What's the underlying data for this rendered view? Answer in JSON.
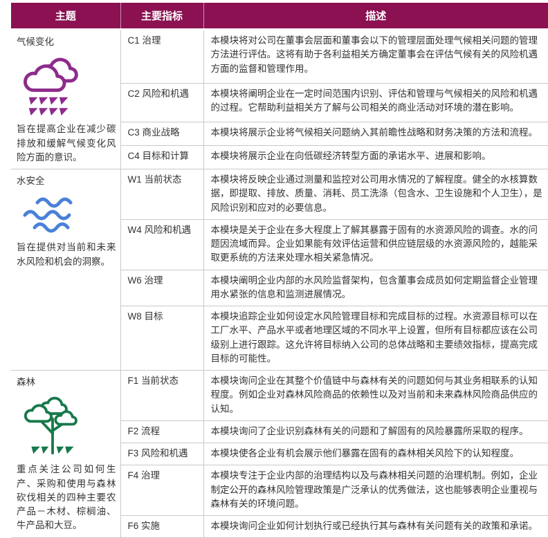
{
  "header": {
    "theme": "主题",
    "indicator": "主要指标",
    "description": "描述"
  },
  "sections": [
    {
      "id": "climate",
      "theme_title": "气候变化",
      "theme_icon": "climate-rain-cloud-icon",
      "theme_description": "旨在提高企业在减少碳排放和缓解气候变化风险方面的意识。",
      "rows": [
        {
          "indicator": "C1 治理",
          "description": "本模块将对公司在董事会层面和董事会以下的管理层面处理气候相关问题的管理方法进行评估。这将有助于各利益相关方确定董事会在评估气候有关的风险机遇方面的监督和管理作用。"
        },
        {
          "indicator": "C2 风险和机遇",
          "description": "本模块将阐明企业在一定时间范围内识别、评估和管理与气候相关的风险和机遇的过程。它帮助利益相关方了解与公司相关的商业活动对环境的潜在影响。"
        },
        {
          "indicator": "C3 商业战略",
          "description": "本模块将展示企业将气候相关问题纳入其前瞻性战略和财务决策的方法和流程。"
        },
        {
          "indicator": "C4 目标和计算",
          "description": "本模块将展示企业在向低碳经济转型方面的承诺水平、进展和影响。"
        }
      ]
    },
    {
      "id": "water",
      "theme_title": "水安全",
      "theme_icon": "water-waves-icon",
      "theme_description": "旨在提供对当前和未来水风险和机会的洞察。",
      "rows": [
        {
          "indicator": "W1 当前状态",
          "description": "本模块将反映企业通过测量和监控对公司用水情况的了解程度。健全的水核算数据，即提取、排放、质量、消耗、员工洗涤（包含水、卫生设施和个人卫生），是风险识别和应对的必要信息。"
        },
        {
          "indicator": "W4 风险和机遇",
          "description": "本模块是关于企业在多大程度上了解其暴露于固有的水资源风险的调查。水的问题因流域而异。企业如果能有效评估运营和供应链层级的水资源风险的，越能采取更系统的方法来处理水相关紧急情况。"
        },
        {
          "indicator": "W6 治理",
          "description": "本模块阐明企业内部的水风险监督架构，包含董事会成员如何定期监督企业管理用水紧张的信息和监测进展情况。"
        },
        {
          "indicator": "W8 目标",
          "description": "本模块追踪企业如何设定水风险管理目标和完成目标的过程。水资源目标可以在工厂水平、产品水平或者地理区域的不同水平上设置，但所有目标都应该在公司级别上进行跟踪。这允许将目标纳入公司的总体战略和主要绩效指标，提高完成目标的可能性。"
        }
      ]
    },
    {
      "id": "forest",
      "theme_title": "森林",
      "theme_icon": "forest-tree-icon",
      "theme_description": "重点关注公司如何生产、采购和使用与森林砍伐相关的四种主要农产品－木材、棕榈油、牛产品和大豆。",
      "rows": [
        {
          "indicator": "F1 当前状态",
          "description": "本模块询问企业在其整个价值链中与森林有关的问题如何与其业务相联系的认知程度。例如企业对森林风险商品的依赖性以及对当前和未来森林风险商品供应的认知。"
        },
        {
          "indicator": "F2 流程",
          "description": "本模块询问了企业识别森林有关的问题和了解固有的风险暴露所采取的程序。"
        },
        {
          "indicator": "F3 风险和机遇",
          "description": "本模块使各企业有机会展示他们暴露在固有的森林相关风险下的认知程度。"
        },
        {
          "indicator": "F4 治理",
          "description": "本模块专注于企业内部的治理结构以及与森林相关问题的治理机制。例如，企业制定公开的森林风险管理政策是广泛承认的优秀做法，这也能够表明企业重视与森林有关的环境问题。"
        },
        {
          "indicator": "F6 实施",
          "description": "本模块询问企业如何计划执行或已经执行其与森林有关问题有关的政策和承诺。"
        }
      ]
    }
  ],
  "colors": {
    "header_bg": "#8B1152",
    "climate_icon": "#8E2B8C",
    "water_icon": "#4A80D8",
    "forest_icon": "#17794B",
    "row_border": "#C9C9C9",
    "text": "#333333"
  }
}
